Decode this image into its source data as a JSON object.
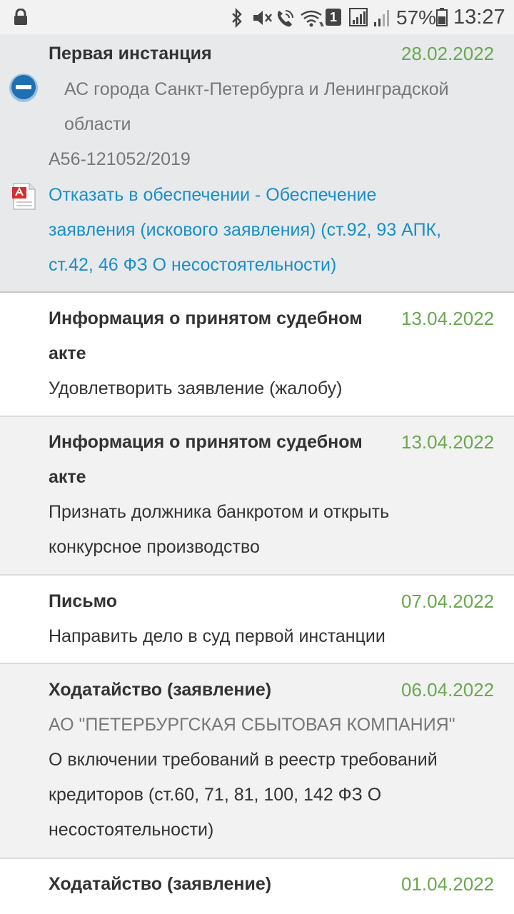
{
  "status_bar": {
    "sim_slot": "1",
    "battery_percent": "57%",
    "time": "13:27",
    "icons": [
      "lock-icon",
      "bluetooth-icon",
      "mute-icon",
      "wifi-calling-icon",
      "wifi-icon",
      "signal-icon",
      "battery-icon"
    ]
  },
  "header": {
    "title": "Первая инстанция",
    "date": "28.02.2022",
    "court_line1": "АС города Санкт-Петербурга и Ленинградской",
    "court_line2": "области",
    "case_number": "А56-121052/2019",
    "doc_line1": "Отказать в обеспечении - Обеспечение",
    "doc_line2": "заявления (искового заявления) (ст.92, 93 АПК,",
    "doc_line3": "ст.42, 46 ФЗ О несостоятельности)"
  },
  "events": [
    {
      "title_line1": "Информация о принятом судебном",
      "title_line2": "акте",
      "date": "13.04.2022",
      "text_line1": "Удовлетворить заявление (жалобу)"
    },
    {
      "title_line1": "Информация о принятом судебном",
      "title_line2": "акте",
      "date": "13.04.2022",
      "text_line1": "Признать должника банкротом и открыть",
      "text_line2": "конкурсное производство"
    },
    {
      "title_line1": "Письмо",
      "date": "07.04.2022",
      "text_line1": "Направить дело в суд первой инстанции"
    },
    {
      "title_line1": "Ходатайство (заявление)",
      "date": "06.04.2022",
      "party": "АО \"ПЕТЕРБУРГСКАЯ СБЫТОВАЯ КОМПАНИЯ\"",
      "text_line1": "О включении требований в реестр требований",
      "text_line2": "кредиторов (ст.60, 71, 81, 100, 142 ФЗ О",
      "text_line3": "несостоятельности)"
    },
    {
      "title_line1": "Ходатайство (заявление)",
      "date": "01.04.2022"
    }
  ],
  "colors": {
    "date_green": "#6aa84f",
    "link_blue": "#1a8fc7",
    "header_bg": "#e7e9eb",
    "row_grey": "#f2f2f2"
  }
}
